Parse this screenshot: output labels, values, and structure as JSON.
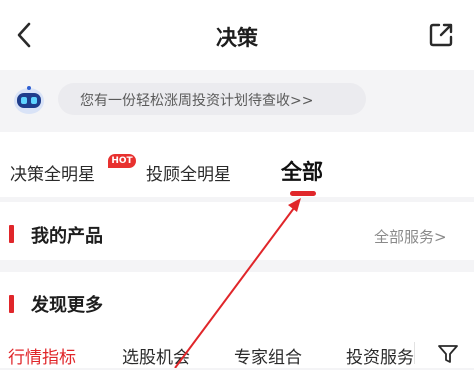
{
  "header": {
    "title": "决策",
    "back_icon": "chevron-left-icon",
    "share_icon": "share-external-icon"
  },
  "notice": {
    "icon": "robot-assistant-icon",
    "text": "您有一份轻松涨周投资计划待查收>>"
  },
  "tabs": [
    {
      "label": "决策全明星",
      "badge": "HOT",
      "active": false
    },
    {
      "label": "投顾全明星",
      "active": false
    },
    {
      "label": "全部",
      "active": true
    }
  ],
  "products": {
    "title": "我的产品",
    "link": "全部服务>"
  },
  "discover": {
    "title": "发现更多",
    "categories": [
      {
        "label": "行情指标",
        "active": true
      },
      {
        "label": "选股机会",
        "active": false
      },
      {
        "label": "专家组合",
        "active": false
      },
      {
        "label": "投资服务",
        "active": false
      }
    ],
    "filter_icon": "filter-funnel-icon"
  },
  "colors": {
    "accent": "#e0262a",
    "background": "#f4f4f6",
    "card": "#ffffff",
    "muted_text": "#8a8a8a",
    "hot_badge": "#e8312f"
  },
  "annotation": {
    "type": "arrow",
    "color": "#e0262a",
    "points_to": "tab-all"
  }
}
